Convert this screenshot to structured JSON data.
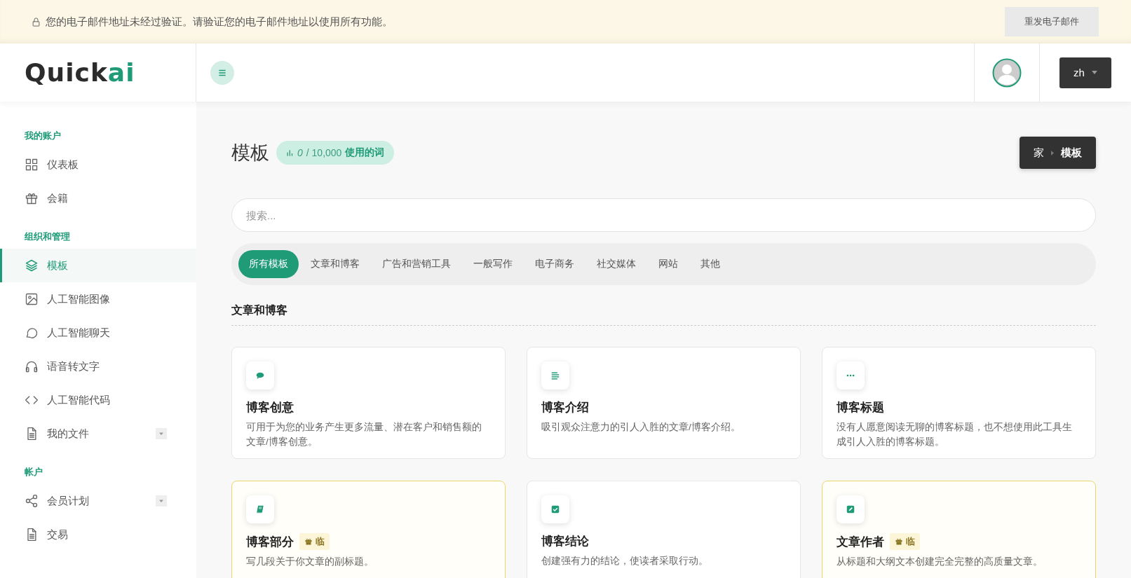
{
  "banner": {
    "message": "您的电子邮件地址未经过验证。请验证您的电子邮件地址以使用所有功能。",
    "button": "重发电子邮件"
  },
  "logo": {
    "main": "Quick",
    "accent": "ai"
  },
  "header": {
    "language": "zh"
  },
  "sidebar": {
    "sections": [
      {
        "heading": "我的账户",
        "items": [
          {
            "label": "仪表板",
            "selected": false,
            "expandable": false
          },
          {
            "label": "会籍",
            "selected": false,
            "expandable": false
          }
        ]
      },
      {
        "heading": "组织和管理",
        "items": [
          {
            "label": "模板",
            "selected": true,
            "expandable": false
          },
          {
            "label": "人工智能图像",
            "selected": false,
            "expandable": false
          },
          {
            "label": "人工智能聊天",
            "selected": false,
            "expandable": false
          },
          {
            "label": "语音转文字",
            "selected": false,
            "expandable": false
          },
          {
            "label": "人工智能代码",
            "selected": false,
            "expandable": false
          },
          {
            "label": "我的文件",
            "selected": false,
            "expandable": true
          }
        ]
      },
      {
        "heading": "帐户",
        "items": [
          {
            "label": "会员计划",
            "selected": false,
            "expandable": true
          },
          {
            "label": "交易",
            "selected": false,
            "expandable": false
          }
        ]
      }
    ]
  },
  "page": {
    "title": "模板",
    "usage": {
      "count": "0",
      "total": "/ 10,000",
      "label": "使用的词"
    },
    "breadcrumb": [
      "家",
      "模板"
    ]
  },
  "search": {
    "placeholder": "搜索..."
  },
  "categories": [
    {
      "label": "所有模板",
      "selected": true
    },
    {
      "label": "文章和博客",
      "selected": false
    },
    {
      "label": "广告和营销工具",
      "selected": false
    },
    {
      "label": "一般写作",
      "selected": false
    },
    {
      "label": "电子商务",
      "selected": false
    },
    {
      "label": "社交媒体",
      "selected": false
    },
    {
      "label": "网站",
      "selected": false
    },
    {
      "label": "其他",
      "selected": false
    }
  ],
  "section_heading": "文章和博客",
  "cards": [
    {
      "title": "博客创意",
      "description": "可用于为您的业务产生更多流量、潜在客户和销售额的文章/博客创意。",
      "premium": false
    },
    {
      "title": "博客介绍",
      "description": "吸引观众注意力的引人入胜的文章/博客介绍。",
      "premium": false
    },
    {
      "title": "博客标题",
      "description": "没有人愿意阅读无聊的博客标题，也不想使用此工具生成引人入胜的博客标题。",
      "premium": false
    },
    {
      "title": "博客部分",
      "description": "写几段关于你文章的副标题。",
      "premium": true,
      "badge": "临"
    },
    {
      "title": "博客结论",
      "description": "创建强有力的结论，使读者采取行动。",
      "premium": false
    },
    {
      "title": "文章作者",
      "description": "从标题和大纲文本创建完全完整的高质量文章。",
      "premium": true,
      "badge": "临"
    }
  ]
}
